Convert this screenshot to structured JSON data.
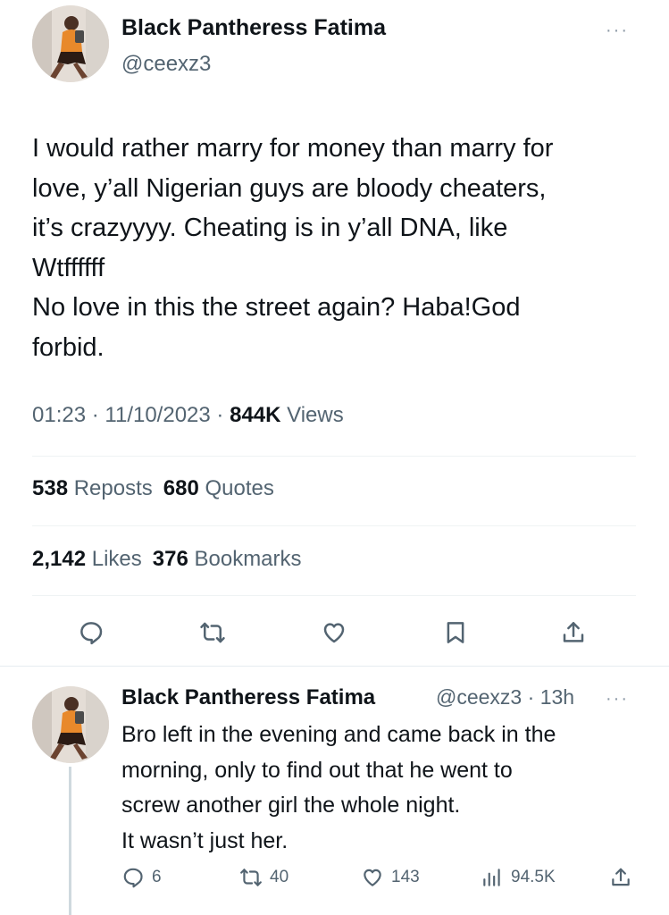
{
  "main_tweet": {
    "author": {
      "display_name": "Black Pantheress Fatima",
      "handle": "@ceexz3"
    },
    "text_lines": [
      "I would rather marry for money than marry for",
      "love, y’all Nigerian guys are bloody cheaters,",
      "it’s crazyyyy. Cheating is in y’all DNA, like",
      "Wtffffff",
      "No love in this the street again? Haba!God",
      "forbid."
    ],
    "time": "01:23",
    "date": "11/10/2023",
    "separator": "·",
    "views_count": "844K",
    "views_label": "Views",
    "reposts_count": "538",
    "reposts_label": "Reposts",
    "quotes_count": "680",
    "quotes_label": "Quotes",
    "likes_count": "2,142",
    "likes_label": "Likes",
    "bookmarks_count": "376",
    "bookmarks_label": "Bookmarks",
    "actions": [
      "reply-icon",
      "repost-icon",
      "like-icon",
      "bookmark-icon",
      "share-icon"
    ]
  },
  "reply_tweet": {
    "author": {
      "display_name": "Black Pantheress Fatima",
      "handle": "@ceexz3",
      "separator": "·",
      "time_ago": "13h"
    },
    "text_lines": [
      "Bro left in the evening and came back in the",
      "morning, only to find out that he went to",
      "screw another girl the whole night.",
      "It wasn’t just her."
    ],
    "replies_count": "6",
    "reposts_count": "40",
    "likes_count": "143",
    "views_count": "94.5K"
  },
  "more_menu": {
    "label": "···"
  },
  "colors": {
    "text": "#0f1419",
    "secondary": "#536471",
    "divider": "#eff3f4",
    "thread_line": "#cfd9de"
  }
}
